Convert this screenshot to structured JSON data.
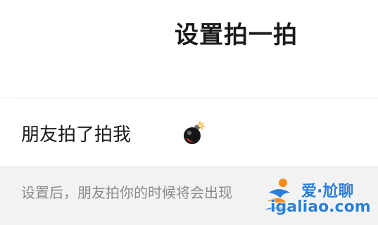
{
  "header": {
    "title": "设置拍一拍"
  },
  "setting": {
    "label": "朋友拍了拍我",
    "value_icon": "bomb-emoji"
  },
  "hint": {
    "text": "设置后，朋友拍你的时候将会出现"
  },
  "watermark": {
    "title": "爱·尬聊",
    "url": "igaliao.com",
    "colors": {
      "blue": "#2a7fd9",
      "orange": "#f08a1c"
    }
  },
  "colors": {
    "page_bg": "#f2f2f2",
    "row_bg": "#ffffff",
    "text_primary": "#1a1a1a",
    "text_secondary": "#8a8a8a"
  }
}
